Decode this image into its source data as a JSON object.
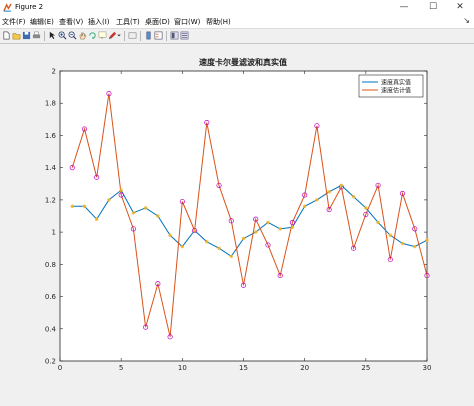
{
  "window": {
    "title": "Figure 2",
    "minimize_glyph": "—",
    "maximize_glyph": "☐",
    "close_glyph": "✕"
  },
  "menu": [
    {
      "label": "文件(F)"
    },
    {
      "label": "编辑(E)"
    },
    {
      "label": "查看(V)"
    },
    {
      "label": "插入(I)"
    },
    {
      "label": "工具(T)"
    },
    {
      "label": "桌面(D)"
    },
    {
      "label": "窗口(W)"
    },
    {
      "label": "帮助(H)"
    }
  ],
  "menu_overflow_glyph": "↘",
  "toolbar": [
    "new-figure-icon",
    "open-file-icon",
    "save-icon",
    "print-icon",
    "select-arrow-icon",
    "zoom-in-icon",
    "zoom-out-icon",
    "pan-hand-icon",
    "rotate-3d-icon",
    "data-cursor-icon",
    "brush-icon",
    "brush-dropdown-icon",
    "link-plot-icon",
    "colorbar-icon",
    "legend-icon",
    "hide-plot-tools-icon",
    "show-plot-tools-icon"
  ],
  "colors": {
    "true_series": "#0072BD",
    "estimate_series": "#D95319",
    "measurement_marker": "#c000c0",
    "true_marker": "#EDB120"
  },
  "chart_data": {
    "type": "line",
    "title": "速度卡尔曼滤波和真实值",
    "xlabel": "",
    "ylabel": "",
    "xlim": [
      0,
      30
    ],
    "ylim": [
      0.2,
      2
    ],
    "xticks": [
      0,
      5,
      10,
      15,
      20,
      25,
      30
    ],
    "yticks": [
      0.2,
      0.4,
      0.6,
      0.8,
      1,
      1.2,
      1.4,
      1.6,
      1.8,
      2
    ],
    "grid": false,
    "legend_position": "top-right",
    "x": [
      1,
      2,
      3,
      4,
      5,
      6,
      7,
      8,
      9,
      10,
      11,
      12,
      13,
      14,
      15,
      16,
      17,
      18,
      19,
      20,
      21,
      22,
      23,
      24,
      25,
      26,
      27,
      28,
      29,
      30
    ],
    "series": [
      {
        "name": "速度真实值",
        "color": "#0072BD",
        "marker": "asterisk",
        "values": [
          1.16,
          1.16,
          1.08,
          1.2,
          1.26,
          1.12,
          1.15,
          1.1,
          0.98,
          0.91,
          1.01,
          0.94,
          0.9,
          0.85,
          0.96,
          1.0,
          1.06,
          1.02,
          1.03,
          1.16,
          1.2,
          1.25,
          1.29,
          1.22,
          1.15,
          1.06,
          0.98,
          0.93,
          0.91,
          0.95
        ]
      },
      {
        "name": "速度估计值",
        "color": "#D95319",
        "marker": "circle",
        "values": [
          1.4,
          1.64,
          1.34,
          1.86,
          1.23,
          1.02,
          0.41,
          0.68,
          0.35,
          1.19,
          1.01,
          1.68,
          1.29,
          1.07,
          0.67,
          1.08,
          0.92,
          0.73,
          1.06,
          1.23,
          1.66,
          1.14,
          1.28,
          0.9,
          1.11,
          1.29,
          0.83,
          1.24,
          1.02,
          0.73
        ]
      }
    ]
  }
}
